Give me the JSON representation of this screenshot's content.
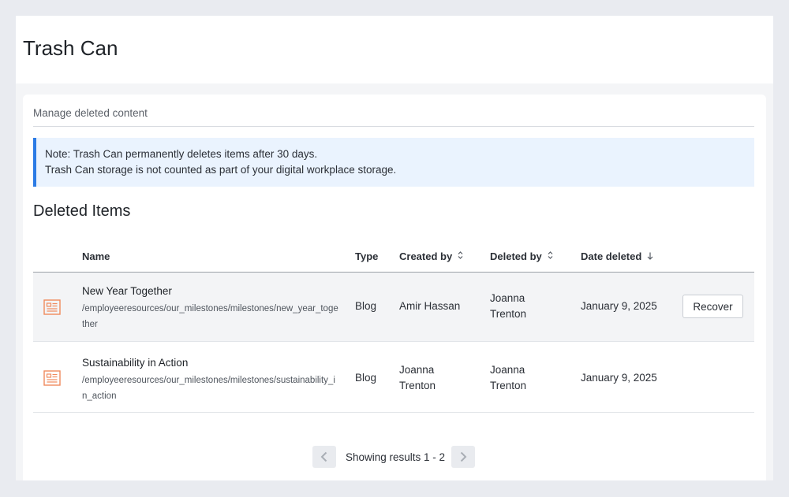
{
  "header": {
    "title": "Trash Can"
  },
  "main": {
    "subtitle": "Manage deleted content",
    "note": {
      "line1": "Note: Trash Can permanently deletes items after 30 days.",
      "line2": "Trash Can storage is not counted as part of your digital workplace storage."
    },
    "section_title": "Deleted Items",
    "table": {
      "columns": {
        "name": "Name",
        "type": "Type",
        "created_by": "Created by",
        "deleted_by": "Deleted by",
        "date_deleted": "Date deleted"
      },
      "rows": [
        {
          "icon": "blog-article-icon",
          "name": "New Year Together",
          "path": "/employeeresources/our_milestones/milestones/new_year_together",
          "type": "Blog",
          "created_by": "Amir Hassan",
          "deleted_by": "Joanna Trenton",
          "date_deleted": "January 9, 2025",
          "action": "Recover"
        },
        {
          "icon": "blog-article-icon",
          "name": "Sustainability in Action",
          "path": "/employeeresources/our_milestones/milestones/sustainability_in_action",
          "type": "Blog",
          "created_by": "Joanna Trenton",
          "deleted_by": "Joanna Trenton",
          "date_deleted": "January 9, 2025"
        }
      ]
    },
    "pagination": {
      "text": "Showing results 1 - 2"
    }
  },
  "colors": {
    "accent": "#2c7be5",
    "note_bg": "#eaf3fe",
    "icon": "#f08a5d",
    "page_bg": "#e9ebf0"
  }
}
